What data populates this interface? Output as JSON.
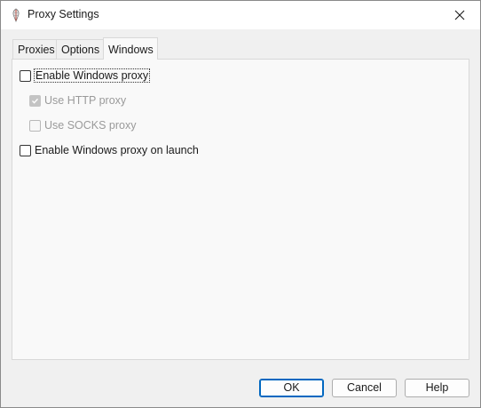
{
  "window": {
    "title": "Proxy Settings"
  },
  "tabs": [
    {
      "label": "Proxies",
      "active": false
    },
    {
      "label": "Options",
      "active": false
    },
    {
      "label": "Windows",
      "active": true
    }
  ],
  "panel": {
    "enable_windows_proxy": {
      "label": "Enable Windows proxy",
      "checked": false,
      "enabled": true
    },
    "use_http_proxy": {
      "label": "Use HTTP proxy",
      "checked": true,
      "enabled": false
    },
    "use_socks_proxy": {
      "label": "Use SOCKS proxy",
      "checked": false,
      "enabled": false
    },
    "enable_on_launch": {
      "label": "Enable Windows proxy on launch",
      "checked": false,
      "enabled": true
    }
  },
  "buttons": {
    "ok": "OK",
    "cancel": "Cancel",
    "help": "Help"
  },
  "icons": {
    "app": "feather-app-icon",
    "close": "close-icon",
    "check": "checkmark-icon"
  },
  "colors": {
    "accent": "#0067c0",
    "disabled_text": "#9a9a9a"
  }
}
